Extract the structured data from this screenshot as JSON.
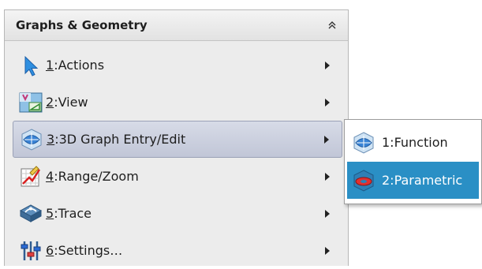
{
  "menu": {
    "title": "Graphs & Geometry",
    "items": [
      {
        "hotkey": "1",
        "label": ":Actions",
        "icon": "pointer-arrow-icon"
      },
      {
        "hotkey": "2",
        "label": ":View",
        "icon": "view-icon"
      },
      {
        "hotkey": "3",
        "label": ":3D Graph Entry/Edit",
        "icon": "3d-graph-icon"
      },
      {
        "hotkey": "4",
        "label": ":Range/Zoom",
        "icon": "range-zoom-icon"
      },
      {
        "hotkey": "5",
        "label": ":Trace",
        "icon": "trace-icon"
      },
      {
        "hotkey": "6",
        "label": ":Settings…",
        "icon": "settings-sliders-icon"
      }
    ]
  },
  "submenu": {
    "items": [
      {
        "label": "1:Function",
        "icon": "3d-function-icon"
      },
      {
        "label": "2:Parametric",
        "icon": "3d-parametric-icon"
      }
    ]
  },
  "colors": {
    "highlight_item": "#c8cddd",
    "selected_subitem": "#2a8fc5",
    "menu_bg": "#ececec"
  }
}
